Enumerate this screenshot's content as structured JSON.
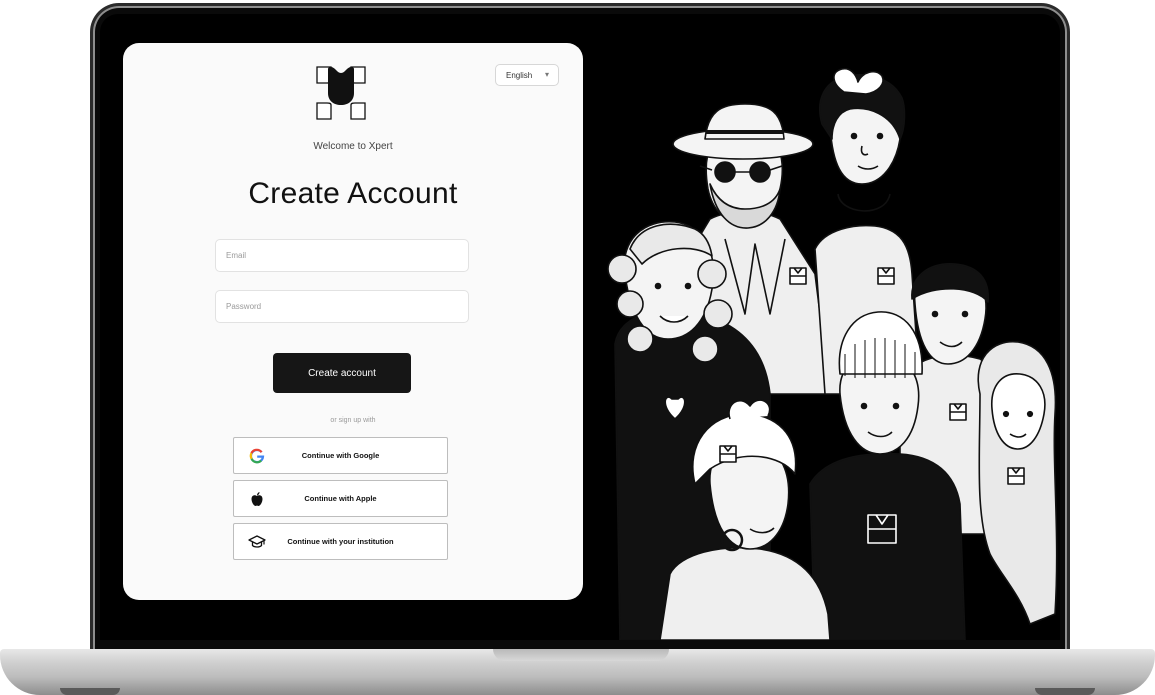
{
  "app": {
    "name": "Xpert"
  },
  "language_select": {
    "value": "English"
  },
  "welcome_text": "Welcome to Xpert",
  "title": "Create Account",
  "fields": {
    "email_placeholder": "Email",
    "password_placeholder": "Password"
  },
  "primary_button": "Create account",
  "divider_text": "or sign up with",
  "oauth": {
    "google": "Continue with Google",
    "apple": "Continue with Apple",
    "institution": "Continue with your institution"
  },
  "icons": [
    "xpert-logo-icon",
    "chevron-down-icon",
    "google-icon",
    "apple-icon",
    "graduation-cap-icon"
  ],
  "colors": {
    "primary": "#161616",
    "card_bg": "#fafafa",
    "screen_bg": "#000000"
  }
}
